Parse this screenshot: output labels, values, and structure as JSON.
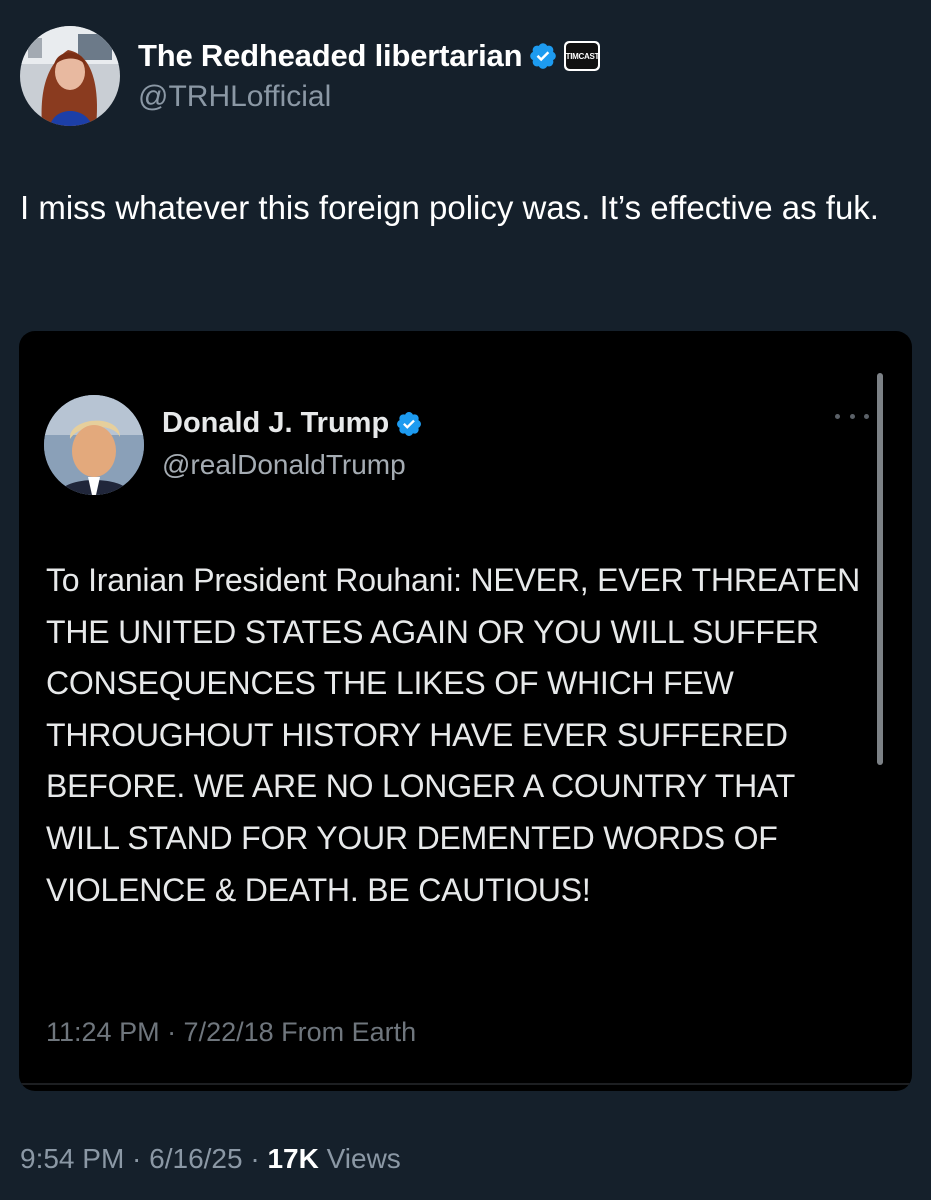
{
  "author": {
    "display_name": "The Redheaded libertarian",
    "handle": "@TRHLofficial",
    "affiliation_badge": "TIMCAST",
    "verified_color": "#1d9bf0"
  },
  "tweet": {
    "text": "I miss whatever this foreign policy was. It’s effective as fuk."
  },
  "quoted_tweet": {
    "display_name": "Donald J. Trump",
    "handle": "@realDonaldTrump",
    "text": "To Iranian President Rouhani: NEVER, EVER THREATEN THE UNITED STATES AGAIN OR YOU WILL SUFFER CONSEQUENCES THE LIKES OF WHICH FEW THROUGHOUT HISTORY HAVE EVER SUFFERED BEFORE. WE ARE NO LONGER A COUNTRY THAT WILL STAND FOR YOUR DEMENTED WORDS OF VIOLENCE & DEATH. BE CAUTIOUS!",
    "meta": "11:24 PM · 7/22/18 From Earth"
  },
  "footer": {
    "timestamp": "9:54 PM · 6/16/25 · ",
    "views_count": "17K",
    "views_label": " Views"
  },
  "icons": {
    "verified": "verified-badge-icon",
    "more": "more-options-icon"
  },
  "colors": {
    "background": "#15202b",
    "quote_background": "#000000",
    "muted_text": "#8b98a5"
  }
}
